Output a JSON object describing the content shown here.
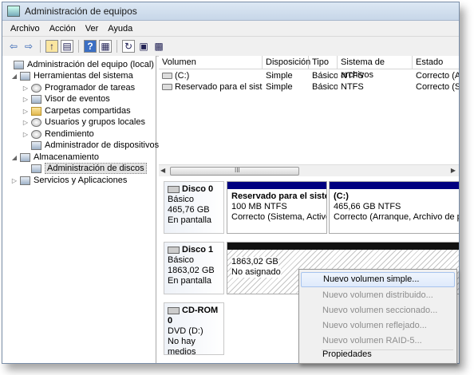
{
  "window": {
    "title": "Administración de equipos"
  },
  "menubar": [
    "Archivo",
    "Acción",
    "Ver",
    "Ayuda"
  ],
  "toolbar": {
    "icons": [
      "back-arrow-icon",
      "forward-arrow-icon",
      "up-folder-icon",
      "show-tree-icon",
      "help-icon",
      "console-icon",
      "refresh-icon",
      "properties-icon",
      "export-icon"
    ]
  },
  "tree": [
    {
      "label": "Administración del equipo (local)",
      "icon": "computer-icon"
    },
    {
      "label": "Herramientas del sistema",
      "icon": "tools-icon"
    },
    {
      "label": "Programador de tareas",
      "icon": "clock-icon"
    },
    {
      "label": "Visor de eventos",
      "icon": "event-viewer-icon"
    },
    {
      "label": "Carpetas compartidas",
      "icon": "shared-folder-icon"
    },
    {
      "label": "Usuarios y grupos locales",
      "icon": "users-icon"
    },
    {
      "label": "Rendimiento",
      "icon": "performance-icon"
    },
    {
      "label": "Administrador de dispositivos",
      "icon": "device-manager-icon"
    },
    {
      "label": "Almacenamiento",
      "icon": "storage-icon"
    },
    {
      "label": "Administración de discos",
      "icon": "disk-management-icon"
    },
    {
      "label": "Servicios y Aplicaciones",
      "icon": "services-icon"
    }
  ],
  "volume_list": {
    "columns": [
      "Volumen",
      "Disposición",
      "Tipo",
      "Sistema de archivos",
      "Estado"
    ],
    "rows": [
      [
        "(C:)",
        "Simple",
        "Básico",
        "NTFS",
        "Correcto (Arranq"
      ],
      [
        "Reservado para el sistema",
        "Simple",
        "Básico",
        "NTFS",
        "Correcto (Sist"
      ]
    ]
  },
  "scroll_grip": "III",
  "disks": [
    {
      "name": "Disco 0",
      "lines": [
        "Básico",
        "465,76 GB",
        "En pantalla"
      ]
    },
    {
      "name": "Disco 1",
      "lines": [
        "Básico",
        "1863,02 GB",
        "En pantalla"
      ]
    },
    {
      "name": "CD-ROM 0",
      "lines": [
        "DVD (D:)",
        "",
        "No hay medios"
      ]
    }
  ],
  "partitions": {
    "reserved": {
      "title": "Reservado para el sistema",
      "line1": "100 MB NTFS",
      "line2": "Correcto (Sistema, Activo, P"
    },
    "c": {
      "title": "(C:)",
      "line1": "465,66 GB NTFS",
      "line2": "Correcto (Arranque, Archivo de pagina"
    },
    "unallocated": {
      "line1": "1863,02 GB",
      "line2": "No asignado"
    }
  },
  "context_menu": {
    "items": [
      {
        "label": "Nuevo volumen simple...",
        "enabled": true,
        "highlighted": true
      },
      {
        "label": "Nuevo volumen distribuido...",
        "enabled": false
      },
      {
        "label": "Nuevo volumen seccionado...",
        "enabled": false
      },
      {
        "label": "Nuevo volumen reflejado...",
        "enabled": false
      },
      {
        "label": "Nuevo volumen RAID-5...",
        "enabled": false
      },
      {
        "label": "Propiedades",
        "enabled": true
      }
    ]
  }
}
